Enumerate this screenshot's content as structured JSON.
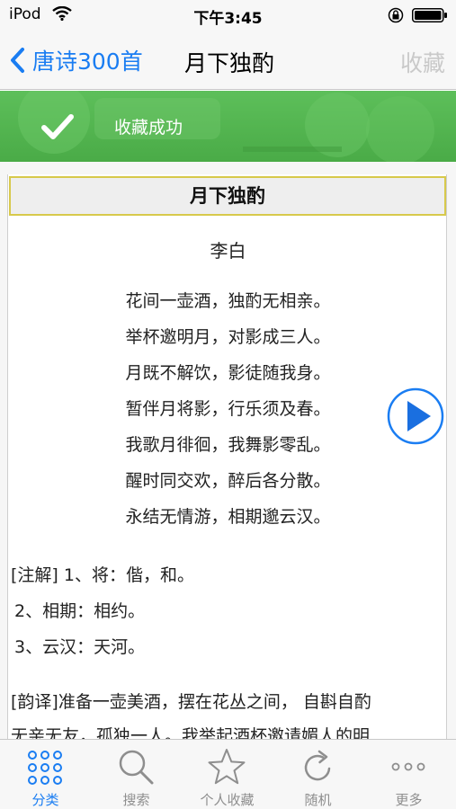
{
  "status_bar": {
    "carrier": "iPod",
    "time": "下午3:45"
  },
  "nav": {
    "back_label": "唐诗300首",
    "title": "月下独酌",
    "collect_label": "收藏"
  },
  "banner": {
    "message": "收藏成功"
  },
  "poem": {
    "title": "月下独酌",
    "author": "李白",
    "lines": [
      "花间一壶酒，独酌无相亲。",
      "举杯邀明月，对影成三人。",
      "月既不解饮，影徒随我身。",
      "暂伴月将影，行乐须及春。",
      "我歌月徘徊，我舞影零乱。",
      "醒时同交欢，醉后各分散。",
      "永结无情游，相期邈云汉。"
    ],
    "notes": [
      "[注解] 1、将：偕，和。",
      "2、相期：相约。",
      "3、云汉：天河。"
    ],
    "translation_lines": [
      "[韵译]准备一壶美酒，摆在花丛之间， 自斟自酌",
      "无亲无友，孤独一人。我举起酒杯邀请媚人的明"
    ]
  },
  "tabs": [
    {
      "label": "分类",
      "icon": "grid-dots-icon",
      "active": true
    },
    {
      "label": "搜索",
      "icon": "search-icon",
      "active": false
    },
    {
      "label": "个人收藏",
      "icon": "star-icon",
      "active": false
    },
    {
      "label": "随机",
      "icon": "refresh-icon",
      "active": false
    },
    {
      "label": "更多",
      "icon": "more-dots-icon",
      "active": false
    }
  ],
  "colors": {
    "accent": "#1a7df2",
    "banner_green": "#52b54f",
    "title_border": "#d7c94b",
    "tab_inactive": "#8e8e8e"
  }
}
